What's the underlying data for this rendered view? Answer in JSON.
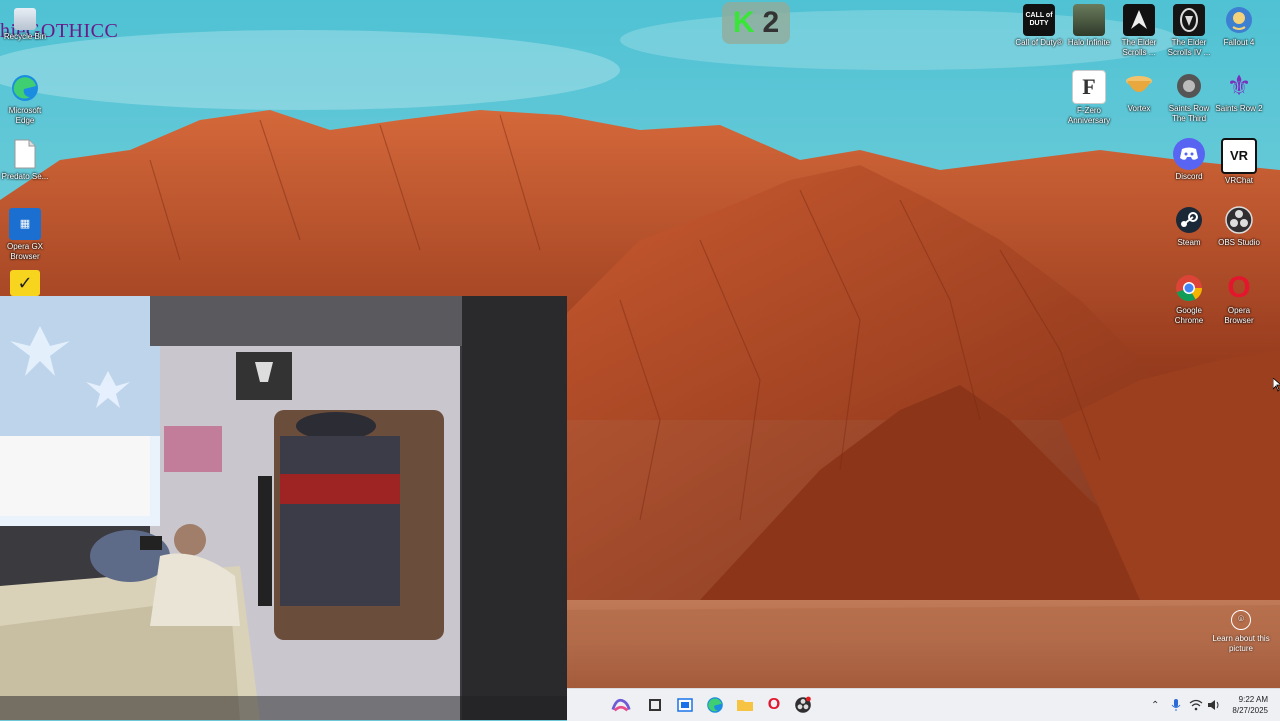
{
  "overlay": {
    "title": "hieGOTHICC",
    "badge_letter": "K",
    "badge_number": "2"
  },
  "desktop_icons_left": [
    {
      "label": "Recycle Bin",
      "icon": "recycle-bin-icon"
    },
    {
      "label": "Microsoft Edge",
      "icon": "edge-icon"
    },
    {
      "label": "Predato Se...",
      "icon": "file-icon"
    },
    {
      "label": "Opera GX Browser",
      "icon": "opera-gx-icon"
    },
    {
      "label": "",
      "icon": "norton-check-icon"
    }
  ],
  "desktop_icons_right": [
    {
      "label": "Call of Duty®",
      "icon": "call-of-duty-icon",
      "glyph": "CALL of DUTY"
    },
    {
      "label": "Halo Infinite",
      "icon": "halo-infinite-icon",
      "glyph": ""
    },
    {
      "label": "The Elder Scrolls ...",
      "icon": "elder-scrolls-icon",
      "glyph": ""
    },
    {
      "label": "The Elder Scrolls IV ...",
      "icon": "elder-scrolls-iv-icon",
      "glyph": ""
    },
    {
      "label": "Fallout 4",
      "icon": "fallout-4-icon",
      "glyph": ""
    },
    {
      "label": "F-Zero Anniversary",
      "icon": "f-zero-icon",
      "glyph": "F"
    },
    {
      "label": "Vortex",
      "icon": "vortex-icon",
      "glyph": ""
    },
    {
      "label": "Saints Row The Third",
      "icon": "saints-row-third-icon",
      "glyph": ""
    },
    {
      "label": "Saints Row 2",
      "icon": "saints-row-2-icon",
      "glyph": "⚜"
    },
    {
      "label": "Discord",
      "icon": "discord-icon",
      "glyph": ""
    },
    {
      "label": "VRChat",
      "icon": "vrchat-icon",
      "glyph": "VR"
    },
    {
      "label": "Steam",
      "icon": "steam-icon",
      "glyph": ""
    },
    {
      "label": "OBS Studio",
      "icon": "obs-studio-icon",
      "glyph": ""
    },
    {
      "label": "Google Chrome",
      "icon": "chrome-icon",
      "glyph": ""
    },
    {
      "label": "Opera Browser",
      "icon": "opera-icon",
      "glyph": "O"
    }
  ],
  "learn_more": {
    "label": "Learn about this picture"
  },
  "taskbar": {
    "apps": [
      {
        "name": "copilot",
        "icon": "copilot-icon"
      },
      {
        "name": "task-view",
        "icon": "task-view-icon"
      },
      {
        "name": "store",
        "icon": "store-icon"
      },
      {
        "name": "edge",
        "icon": "edge-icon"
      },
      {
        "name": "file-explorer",
        "icon": "folder-icon"
      },
      {
        "name": "opera",
        "icon": "opera-icon"
      },
      {
        "name": "obs",
        "icon": "obs-icon"
      }
    ],
    "time": "9:22 AM",
    "date": "8/27/2025"
  },
  "colors": {
    "sky": "#6fc8d8",
    "rock": "#b9532c",
    "overlay_title": "#6a1b8a",
    "badge_k": "#37e637",
    "taskbar": "#eef0f4"
  }
}
